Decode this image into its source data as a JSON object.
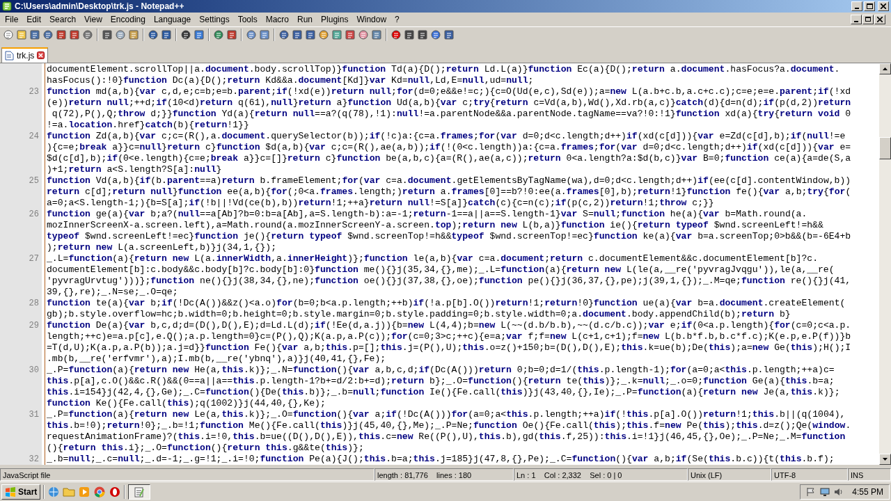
{
  "window": {
    "title": "C:\\Users\\admin\\Desktop\\trk.js - Notepad++"
  },
  "menu": [
    "File",
    "Edit",
    "Search",
    "View",
    "Encoding",
    "Language",
    "Settings",
    "Tools",
    "Macro",
    "Run",
    "Plugins",
    "Window",
    "?"
  ],
  "tabs": [
    {
      "label": "trk.js",
      "selected": true
    }
  ],
  "editor": {
    "lines": [
      {
        "starts_bold": false,
        "parts": [
          "documentElement.scrollTop||a.",
          "document",
          ".body.scrollTop)}",
          "function",
          " Td(a){D();",
          "return",
          " Ld.L(a)}",
          "function",
          " Ec(a){D();",
          "return",
          " a.",
          "document",
          ".hasFocus?a.",
          "document",
          "."
        ]
      },
      {
        "starts_bold": false,
        "parts": [
          "hasFocus():!0}",
          "function",
          " Dc(a){D();",
          "return",
          " Kd&&a.",
          "document",
          "[Kd]}",
          "var",
          " Kd=",
          "null",
          ",Ld,E=",
          "null",
          ",ud=",
          "null",
          ";"
        ]
      },
      {
        "number": "23",
        "starts_bold": true,
        "parts": [
          "function",
          " md(a,b){",
          "var",
          " c,d,e;c=b;e=b.",
          "parent",
          ";",
          "if",
          "(!xd(e))",
          "return null",
          ";",
          "for",
          "(d=0;e&&e!=c;){c=O(Ud(e,c),Sd(e));a=",
          "new",
          " L(a.b+c.b,a.c+c.c);c=e;e=e.",
          "parent",
          ";",
          "if",
          "(!xd"
        ]
      },
      {
        "starts_bold": false,
        "parts": [
          "(e))",
          "return null",
          ";++d;",
          "if",
          "(10<d)",
          "return",
          " q(61),",
          "null",
          "}",
          "return",
          " a}",
          "function",
          " Ud(a,b){",
          "var",
          " c;",
          "try",
          "{",
          "return",
          " c=Vd(a,b),Wd(),Xd.rb(a,c)}",
          "catch",
          "(d){d=n(d);",
          "if",
          "(p(d,2))",
          "return"
        ]
      },
      {
        "starts_bold": false,
        "parts": [
          " q(72),P(),Q;",
          "throw",
          " d;}}",
          "function",
          " Yd(a){",
          "return null",
          "==a?(q(78),!1):",
          "null",
          "!=a.parentNode&&a.parentNode.tagName==va?!0:!1}",
          "function",
          " xd(a){",
          "try",
          "{",
          "return void",
          " 0"
        ]
      },
      {
        "starts_bold": false,
        "parts": [
          "!=a.",
          "location",
          ".href}",
          "catch",
          "(b){",
          "return",
          "!1}}"
        ]
      },
      {
        "number": "24",
        "starts_bold": true,
        "parts": [
          "function",
          " Zd(a,b){",
          "var",
          " c;c=(R(),a.",
          "document",
          ".querySelector(b));",
          "if",
          "(!c)a:{c=a.",
          "frames",
          ";",
          "for",
          "(",
          "var",
          " d=0;d<c.length;d++)",
          "if",
          "(xd(c[d])){",
          "var",
          " e=Zd(c[d],b);",
          "if",
          "(",
          "null",
          "!=e"
        ]
      },
      {
        "starts_bold": false,
        "parts": [
          "){c=e;",
          "break",
          " a}}c=",
          "null",
          "}",
          "return",
          " c}",
          "function",
          " $d(a,b){",
          "var",
          " c;c=(R(),ae(a,b));",
          "if",
          "(!(0<c.length))a:{c=a.",
          "frames",
          ";",
          "for",
          "(",
          "var",
          " d=0;d<c.length;d++)",
          "if",
          "(xd(c[d])){",
          "var",
          " e="
        ]
      },
      {
        "starts_bold": false,
        "parts": [
          "$d(c[d],b);",
          "if",
          "(0<e.length){c=e;",
          "break",
          " a}}c=[]}",
          "return",
          " c}",
          "function",
          " be(a,b,c){a=(R(),ae(a,c));",
          "return",
          " 0<a.length?a:$d(b,c)}",
          "var",
          " B=0;",
          "function",
          " ce(a){a=de(S,a"
        ]
      },
      {
        "starts_bold": false,
        "parts": [
          ")+1;",
          "return",
          " a<S.length?S[a]:",
          "null",
          "}"
        ]
      },
      {
        "number": "25",
        "starts_bold": true,
        "parts": [
          "function",
          " Vd(a,b){",
          "if",
          "(b.",
          "parent",
          "==a)",
          "return",
          " b.frameElement;",
          "for",
          "(",
          "var",
          " c=a.",
          "document",
          ".getElementsByTagName(wa),d=0;d<c.length;d++)",
          "if",
          "(ee(c[d].contentWindow,b))"
        ]
      },
      {
        "starts_bold": true,
        "parts": [
          "return",
          " c[d];",
          "return null",
          "}",
          "function",
          " ee(a,b){",
          "for",
          "(;0<a.",
          "frames",
          ".length;)",
          "return",
          " a.",
          "frames",
          "[0]==b?!0:ee(a.",
          "frames",
          "[0],b);",
          "return",
          "!1}",
          "function",
          " fe(){",
          "var",
          " a,b;",
          "try",
          "{",
          "for",
          "("
        ]
      },
      {
        "starts_bold": false,
        "parts": [
          "a=0;a<S.length-1;){b=S[a];",
          "if",
          "(!b||!Vd(ce(b),b))",
          "return",
          "!1;++a}",
          "return null",
          "!=S[a]}",
          "catch",
          "(c){c=n(c);",
          "if",
          "(p(c,2))",
          "return",
          "!1;",
          "throw",
          " c;}}"
        ]
      },
      {
        "number": "26",
        "starts_bold": true,
        "parts": [
          "function",
          " ge(a){",
          "var",
          " b;a?(",
          "null",
          "==a[Ab]?b=0:b=a[Ab],a=S.length-b):a=-1;",
          "return",
          "-1==a||a==S.length-1}",
          "var",
          " S=",
          "null",
          ";",
          "function",
          " he(a){",
          "var",
          " b=Math.round(a."
        ]
      },
      {
        "starts_bold": false,
        "parts": [
          "mozInnerScreenX-a.screen.left),a=Math.round(a.mozInnerScreenY-a.screen.",
          "top",
          ");",
          "return new",
          " L(b,a)}",
          "function",
          " ie(){",
          "return typeof",
          " $wnd.screenLeft!=h&&"
        ]
      },
      {
        "starts_bold": true,
        "parts": [
          "typeof",
          " $wnd.screenLeft!=ec}",
          "function",
          " je(){",
          "return typeof",
          " $wnd.screenTop!=h&&",
          "typeof",
          " $wnd.screenTop!=ec}",
          "function",
          " ke(a){",
          "var",
          " b=a.screenTop;0>b&&(b=-6E4+b"
        ]
      },
      {
        "starts_bold": false,
        "parts": [
          ");",
          "return new",
          " L(a.screenLeft,b)}j(34,1,{});"
        ]
      },
      {
        "number": "27",
        "starts_bold": false,
        "parts": [
          "_.L=",
          "function",
          "(a){",
          "return new",
          " L(a.",
          "innerWidth",
          ",a.",
          "innerHeight",
          ")};",
          "function",
          " le(a,b){",
          "var",
          " c=a.",
          "document",
          ";",
          "return",
          " c.documentElement&&c.documentElement[b]?c."
        ]
      },
      {
        "starts_bold": false,
        "parts": [
          "documentElement[b]:c.body&&c.body[b]?c.body[b]:0}",
          "function",
          " me(){}j(35,34,{},me);_.L=",
          "function",
          "(a){",
          "return new",
          " L(le(a,__re('pyvragJvqgu')),le(a,__re("
        ]
      },
      {
        "starts_bold": false,
        "parts": [
          "'pyvragUrvtug')))};",
          "function",
          " ne(){}j(38,34,{},ne);",
          "function",
          " oe(){}j(37,38,{},oe);",
          "function",
          " pe(){}j(36,37,{},pe);j(39,1,{});_.M=qe;",
          "function",
          " re(){}j(41,"
        ]
      },
      {
        "starts_bold": false,
        "parts": [
          "39,{},re);_.N=se;_.O=qe;"
        ]
      },
      {
        "number": "28",
        "starts_bold": true,
        "parts": [
          "function",
          " te(a){",
          "var",
          " b;",
          "if",
          "(!Dc(A())&&z()<a.o)",
          "for",
          "(b=0;b<a.p.length;++b)",
          "if",
          "(!a.p[b].O())",
          "return",
          "!1;",
          "return",
          "!0}",
          "function",
          " ue(a){",
          "var",
          " b=a.",
          "document",
          ".createElement("
        ]
      },
      {
        "starts_bold": false,
        "parts": [
          "gb);b.style.overflow=hc;b.width=0;b.height=0;b.style.margin=0;b.style.padding=0;b.style.width=0;a.",
          "document",
          ".body.appendChild(b);",
          "return",
          " b}"
        ]
      },
      {
        "number": "29",
        "starts_bold": true,
        "parts": [
          "function",
          " De(a){",
          "var",
          " b,c,d;d=(D(),D(),E);d=Ld.L(d);",
          "if",
          "(!Ee(d,a.j)){b=",
          "new",
          " L(4,4);b=",
          "new",
          " L(~~(d.b/b.b),~~(d.c/b.c));",
          "var",
          " e;",
          "if",
          "(0<a.p.length){",
          "for",
          "(c=0;c<a.p."
        ]
      },
      {
        "starts_bold": false,
        "parts": [
          "length;++c)e=a.p[c],e.Q();a.p.length=0}c=(P(),Q);K(a.p,a.P(c));",
          "for",
          "(c=0;3>c;++c){e=a;",
          "var",
          " f;f=",
          "new",
          " L(c+1,c+1);f=",
          "new",
          " L(b.b*f.b,b.c*f.c);K(e.p,e.P(f))}b"
        ]
      },
      {
        "starts_bold": false,
        "parts": [
          "=T(d,U);K(a.p,a.P(b));a.j=d}}",
          "function",
          " Fe(){",
          "var",
          " a,b;",
          "this",
          ".p=[];",
          "this",
          ".j=(P(),U);",
          "this",
          ".o=z()+150;b=(D(),D(),E);",
          "this",
          ".k=ue(b);De(",
          "this",
          ");a=",
          "new",
          " Ge(",
          "this",
          ");H();I"
        ]
      },
      {
        "starts_bold": false,
        "parts": [
          ".mb(b,__re('erfvmr'),a);I.mb(b,__re('ybnq'),a)}j(40,41,{},Fe);"
        ]
      },
      {
        "number": "30",
        "starts_bold": false,
        "parts": [
          "_.P=",
          "function",
          "(a){",
          "return new",
          " He(a,",
          "this",
          ".k)};_.N=",
          "function",
          "(){",
          "var",
          " a,b,c,d;",
          "if",
          "(Dc(A()))",
          "return",
          " 0;b=0;d=1/(",
          "this",
          ".p.length-1);",
          "for",
          "(a=0;a<",
          "this",
          ".p.length;++a)c="
        ]
      },
      {
        "starts_bold": true,
        "parts": [
          "this",
          ".p[a],c.O()&&c.R()&&(0==a||a==",
          "this",
          ".p.length-1?b+=d/2:b+=d);",
          "return",
          " b};_.O=",
          "function",
          "(){",
          "return",
          " te(",
          "this",
          ")};_.k=",
          "null",
          ";_.o=0;",
          "function",
          " Ge(a){",
          "this",
          ".b=a;"
        ]
      },
      {
        "starts_bold": true,
        "parts": [
          "this",
          ".i=154}j(42,4,{},Ge);_.C=",
          "function",
          "(){De(",
          "this",
          ".b)};_.b=",
          "null",
          ";",
          "function",
          " Ie(){Fe.call(",
          "this",
          ")}j(43,40,{},Ie);_.P=",
          "function",
          "(a){",
          "return new",
          " Je(a,",
          "this",
          ".k)};"
        ]
      },
      {
        "starts_bold": true,
        "parts": [
          "function",
          " Ke(){Fe.call(",
          "this",
          ");q(1002)}j(44,40,{},Ke);"
        ]
      },
      {
        "number": "31",
        "starts_bold": false,
        "parts": [
          "_.P=",
          "function",
          "(a){",
          "return new",
          " Le(a,",
          "this",
          ".k)};_.O=",
          "function",
          "(){",
          "var",
          " a;",
          "if",
          "(!Dc(A()))",
          "for",
          "(a=0;a<",
          "this",
          ".p.length;++a)",
          "if",
          "(!",
          "this",
          ".p[a].O())",
          "return",
          "!1;",
          "this",
          ".b||(q(1004),"
        ]
      },
      {
        "starts_bold": true,
        "parts": [
          "this",
          ".b=!0);",
          "return",
          "!0};_.b=!1;",
          "function",
          " Me(){Fe.call(",
          "this",
          ")}j(45,40,{},Me);_.P=Ne;",
          "function",
          " Oe(){Fe.call(",
          "this",
          ");",
          "this",
          ".f=",
          "new",
          " Pe(",
          "this",
          ");",
          "this",
          ".d=z();Qe(",
          "window",
          "."
        ]
      },
      {
        "starts_bold": false,
        "parts": [
          "requestAnimationFrame)?(",
          "this",
          ".i=!0,",
          "this",
          ".b=ue((D(),D(),E)),",
          "this",
          ".c=",
          "new",
          " Re((P(),U),",
          "this",
          ".b),gd(",
          "this",
          ".f,25)):",
          "this",
          ".i=!1}j(46,45,{},Oe);_.P=Ne;_.M=",
          "function"
        ]
      },
      {
        "starts_bold": false,
        "parts": [
          "(){",
          "return this",
          ".i};_.O=",
          "function",
          "(){",
          "return this",
          ".g&&te(",
          "this",
          ")};"
        ]
      },
      {
        "number": "32",
        "starts_bold": false,
        "parts": [
          "_.b=",
          "null",
          ";_.c=",
          "null",
          ";_.d=-1;_.g=!1;_.i=!0;",
          "function",
          " Pe(a){J();",
          "this",
          ".b=a;",
          "this",
          ".j=185}j(47,8,{},Pe);_.C=",
          "function",
          "(){",
          "var",
          " a,b;",
          "if",
          "(Se(",
          "this",
          ".b.c)){t(",
          "this",
          ".b.f);"
        ]
      }
    ]
  },
  "status_bar": [
    "JavaScript file",
    "length : 81,776    lines : 180",
    "Ln : 1    Col : 2,332    Sel : 0 | 0",
    "Unix (LF)",
    "UTF-8",
    "INS"
  ],
  "taskbar": {
    "start": "Start",
    "clock": "4:55 PM"
  }
}
